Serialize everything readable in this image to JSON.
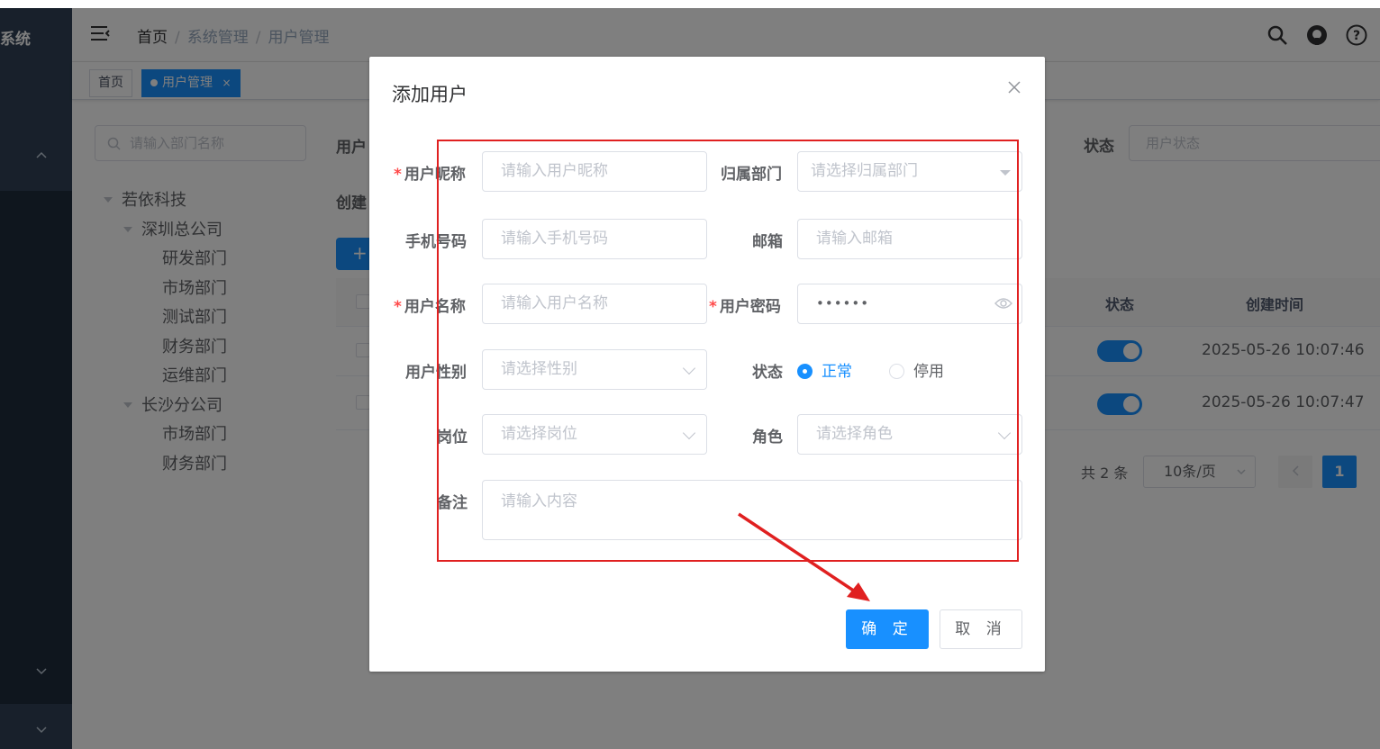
{
  "sidebar": {
    "logo_text": "系统"
  },
  "header": {
    "breadcrumb": [
      "首页",
      "系统管理",
      "用户管理"
    ],
    "icons": [
      "search-icon",
      "github-icon",
      "question-icon"
    ]
  },
  "tags": {
    "home": "首页",
    "active": "用户管理",
    "close": "×"
  },
  "dept": {
    "search_placeholder": "请输入部门名称",
    "tree": [
      {
        "label": "若依科技",
        "level": 1,
        "caret": true
      },
      {
        "label": "深圳总公司",
        "level": 2,
        "caret": true
      },
      {
        "label": "研发部门",
        "level": 3
      },
      {
        "label": "市场部门",
        "level": 3
      },
      {
        "label": "测试部门",
        "level": 3
      },
      {
        "label": "财务部门",
        "level": 3
      },
      {
        "label": "运维部门",
        "level": 3
      },
      {
        "label": "长沙分公司",
        "level": 2,
        "caret": true
      },
      {
        "label": "市场部门",
        "level": 3
      },
      {
        "label": "财务部门",
        "level": 3
      }
    ]
  },
  "background": {
    "label_user": "用户",
    "label_create": "创建",
    "add_btn": "+",
    "status_label": "状态",
    "status_placeholder": "用户状态",
    "col_status": "状态",
    "col_time": "创建时间",
    "rows": [
      {
        "time": "2025-05-26 10:07:46",
        "enabled": true
      },
      {
        "time": "2025-05-26 10:07:47",
        "enabled": true
      }
    ],
    "pagination": {
      "total": "共 2 条",
      "size": "10条/页",
      "page": "1"
    }
  },
  "dialog": {
    "title": "添加用户",
    "fields": {
      "nickname": {
        "label": "用户昵称",
        "placeholder": "请输入用户昵称",
        "required": "*"
      },
      "dept": {
        "label": "归属部门",
        "placeholder": "请选择归属部门"
      },
      "phone": {
        "label": "手机号码",
        "placeholder": "请输入手机号码"
      },
      "email": {
        "label": "邮箱",
        "placeholder": "请输入邮箱"
      },
      "username": {
        "label": "用户名称",
        "placeholder": "请输入用户名称",
        "required": "*"
      },
      "password": {
        "label": "用户密码",
        "value": "••••••",
        "required": "*"
      },
      "gender": {
        "label": "用户性别",
        "placeholder": "请选择性别"
      },
      "status": {
        "label": "状态",
        "options": [
          "正常",
          "停用"
        ],
        "selected": "正常"
      },
      "post": {
        "label": "岗位",
        "placeholder": "请选择岗位"
      },
      "role": {
        "label": "角色",
        "placeholder": "请选择角色"
      },
      "remark": {
        "label": "备注",
        "placeholder": "请输入内容"
      }
    },
    "confirm": "确 定",
    "cancel": "取 消"
  },
  "colors": {
    "primary": "#1890ff",
    "annotation": "#e02020",
    "required": "#ff4949"
  }
}
